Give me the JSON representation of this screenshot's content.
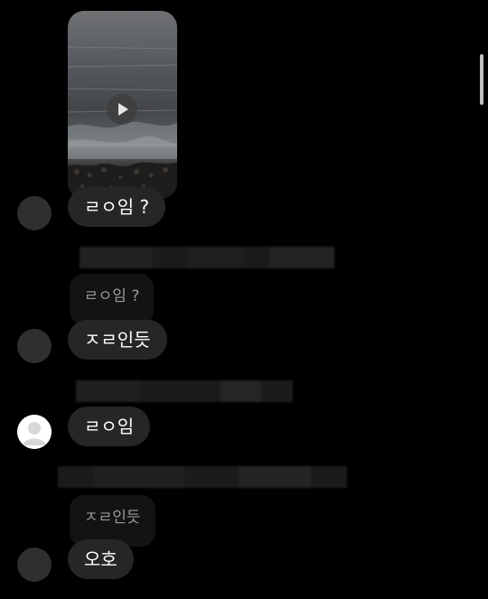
{
  "messages": {
    "reply_to_video": "ㄹㅇ임 ?",
    "quoted_1": "ㄹㅇ임 ?",
    "reply_1": "ㅈㄹ인듯",
    "my_message": "ㄹㅇ임",
    "quoted_2": "ㅈㄹ인듯",
    "reply_2": "오호"
  },
  "icons": {
    "play": "play-icon",
    "avatar": "avatar-icon"
  },
  "colors": {
    "background": "#000000",
    "bubble": "#262626",
    "quote_bubble": "#131313",
    "quote_text": "#9a9a9a",
    "avatar_placeholder": "#2f2f2f"
  }
}
